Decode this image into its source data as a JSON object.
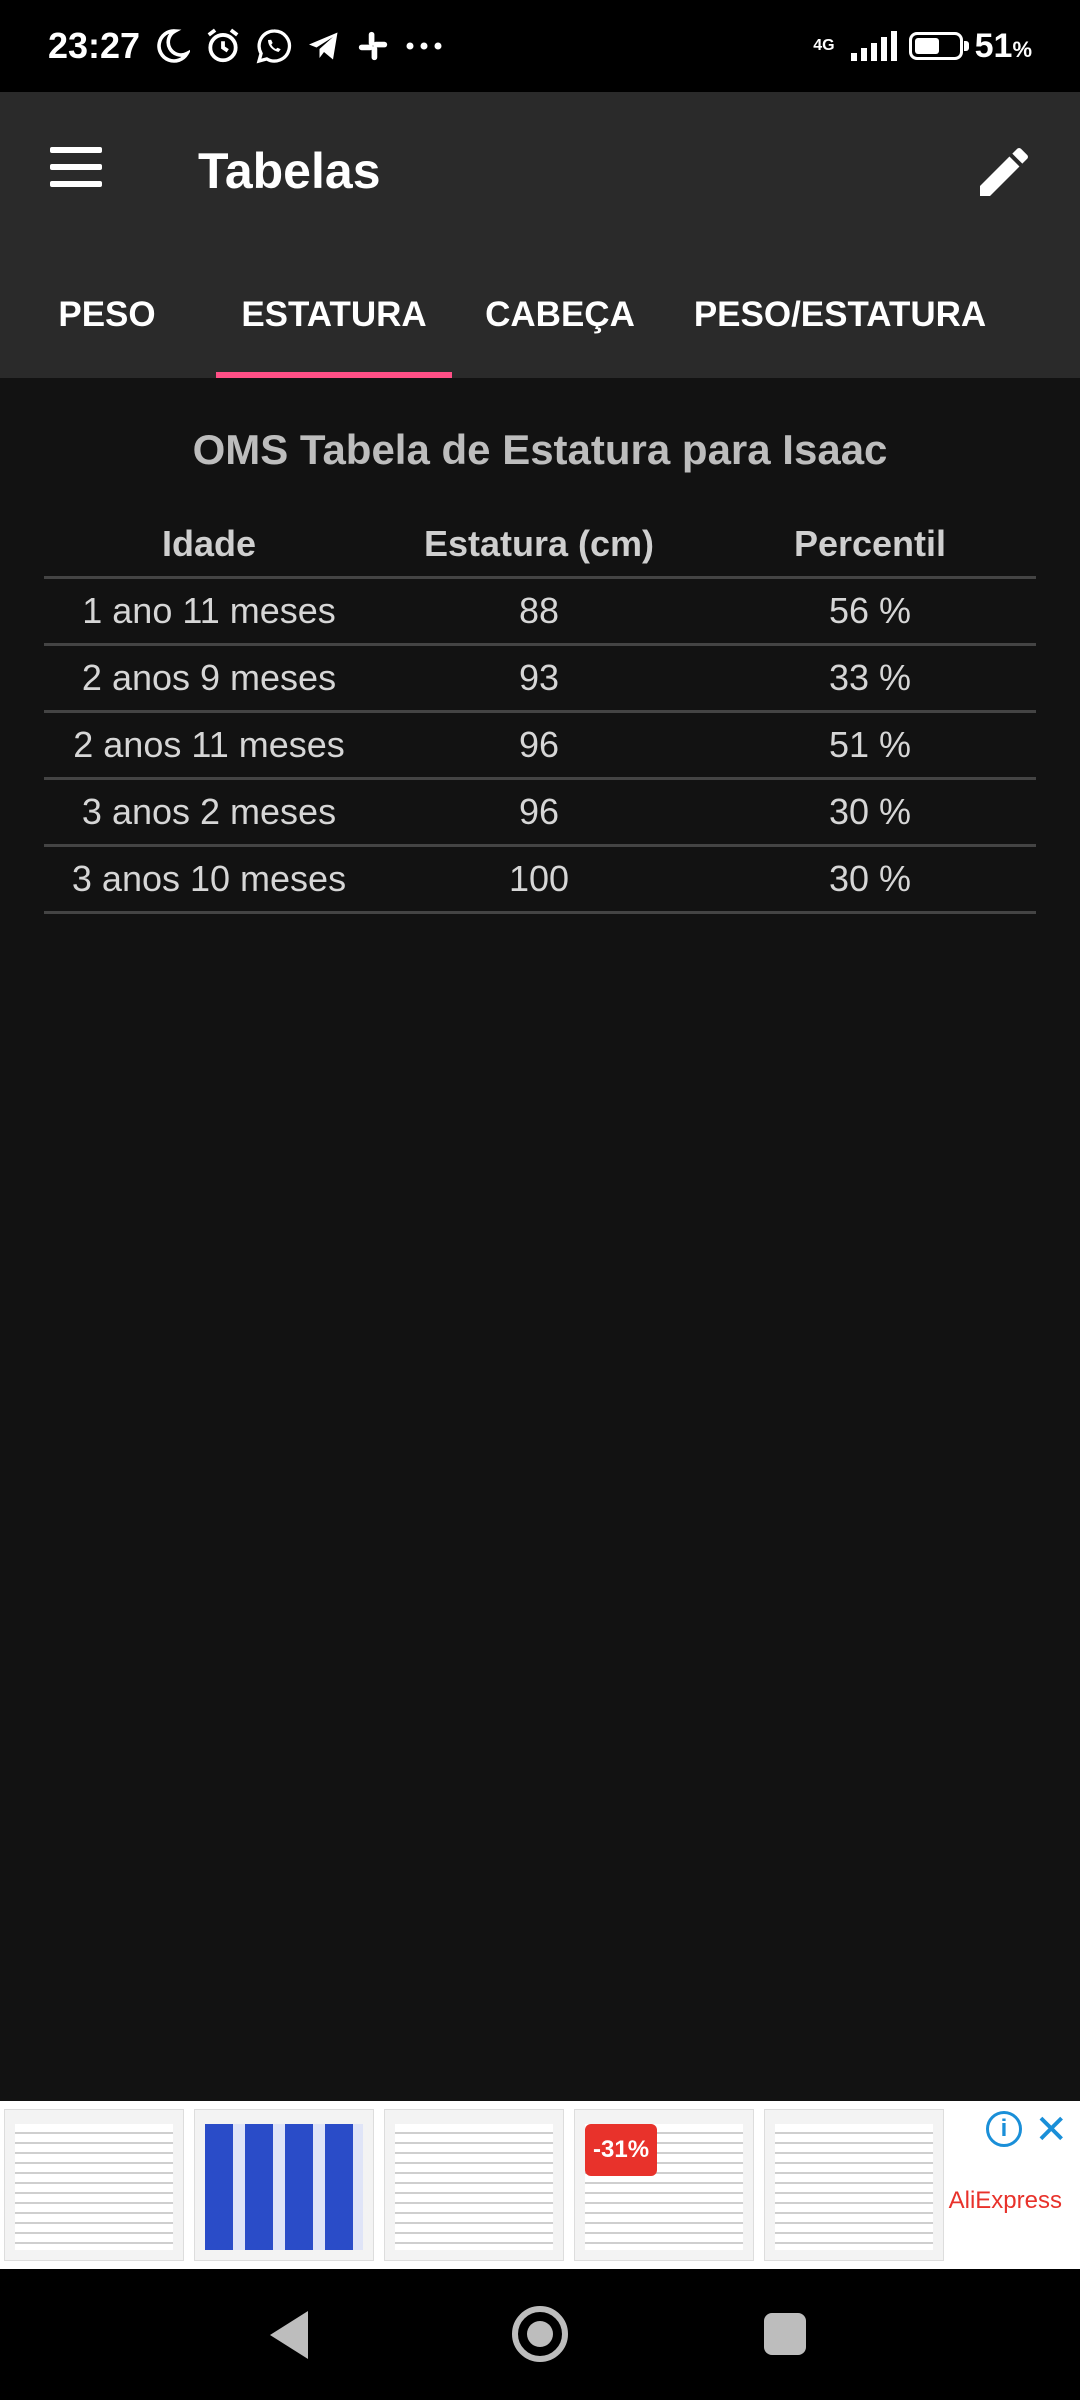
{
  "status_bar": {
    "time": "23:27",
    "icons": [
      "moon-icon",
      "alarm-icon",
      "whatsapp-icon",
      "telegram-icon",
      "slack-icon",
      "more-icon"
    ],
    "network": "4G",
    "battery_percent": "51",
    "battery_unit": "%"
  },
  "app_bar": {
    "title": "Tabelas",
    "menu_icon": "menu-icon",
    "edit_icon": "pencil-icon"
  },
  "tabs": [
    {
      "label": "PESO",
      "active": false
    },
    {
      "label": "ESTATURA",
      "active": true
    },
    {
      "label": "CABEÇA",
      "active": false
    },
    {
      "label": "PESO/ESTATURA",
      "active": false
    }
  ],
  "accent_color": "#ff4f86",
  "table": {
    "title": "OMS Tabela de Estatura para Isaac",
    "headers": [
      "Idade",
      "Estatura (cm)",
      "Percentil"
    ],
    "rows": [
      [
        "1 ano 11 meses",
        "88",
        "56 %"
      ],
      [
        "2 anos 9 meses",
        "93",
        "33 %"
      ],
      [
        "2 anos 11 meses",
        "96",
        "51 %"
      ],
      [
        "3 anos 2 meses",
        "96",
        "30 %"
      ],
      [
        "3 anos 10 meses",
        "100",
        "30 %"
      ]
    ]
  },
  "ad": {
    "discount_badge": "-31%",
    "brand": "AliExpress",
    "info_icon": "info-icon",
    "close_icon": "close-icon"
  },
  "nav_bar": {
    "icons": [
      "back-icon",
      "home-icon",
      "recents-icon"
    ]
  }
}
